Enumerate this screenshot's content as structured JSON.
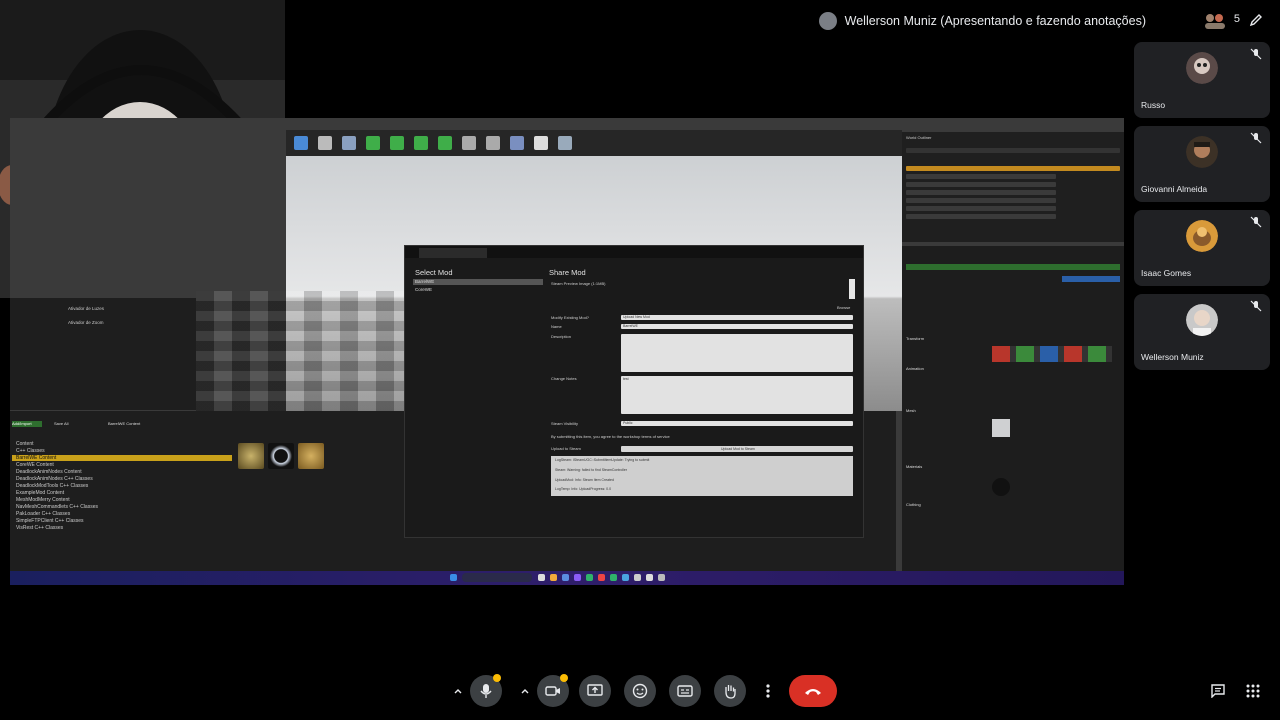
{
  "presenter": {
    "label": "Wellerson Muniz (Apresentando e fazendo anotações)",
    "participant_count": "5"
  },
  "participants": [
    {
      "name": "Russo"
    },
    {
      "name": "Giovanni Almeida"
    },
    {
      "name": "Isaac Gomes"
    },
    {
      "name": "Wellerson Muniz"
    }
  ],
  "shared_screen": {
    "dialog": {
      "select_mod_title": "Select Mod",
      "share_mod_title": "Share Mod",
      "mod_list": [
        "BarrelWE",
        "CoreWE"
      ],
      "fields": {
        "preview_image_label": "Steam Preview Image (1:1MB)",
        "modify_existing_label": "Modify Existing Mod?",
        "modify_existing_value": "Upload New Mod",
        "name_label": "Name",
        "name_value": "BarrelWE",
        "description_label": "Description",
        "change_notes_label": "Change Notes",
        "change_notes_value": "test",
        "visibility_label": "Steam Visibility",
        "visibility_value": "Public",
        "agree_text": "By submitting this item, you agree to the workshop terms of service",
        "upload_label": "Upload to Steam",
        "upload_button": "Upload Mod to Steam",
        "browse_label": "Browse"
      },
      "log_lines": [
        "LogSteam: ISteamUGC::SubmitItemUpdate: Trying to submit",
        "Steam: Warning: failed to find SteamController",
        "UploadMod: Info: Steam Item Created",
        "LogTemp: Info: UploadProgress: 0.0"
      ]
    },
    "content_browser": {
      "tabs": [
        "Add/Import",
        "Save All"
      ],
      "path": "BarrelWE Content",
      "folders": [
        "Content",
        "C++ Classes",
        "BarrelWE Content",
        "CoreWE Content",
        "DeadlockAnimNodes Content",
        "DeadlockAnimNodes C++ Classes",
        "DeadlockModTools C++ Classes",
        "ExampleMod Content",
        "MeshModMerry Content",
        "NavMeshCommandlets C++ Classes",
        "PakLoader C++ Classes",
        "SimpleFTPClient C++ Classes",
        "VisRest C++ Classes"
      ]
    },
    "panels": {
      "left_items": [
        "Ativador de Luzes",
        "Ativador de Zoom"
      ],
      "outliner_title": "World Outliner",
      "details_sections": [
        "Transform",
        "Animation",
        "Mesh",
        "Materials",
        "Clothing"
      ]
    }
  },
  "controls": {
    "buttons": [
      "chevron-up",
      "mic",
      "chevron-up",
      "camera",
      "present",
      "emoji",
      "captions",
      "raise-hand",
      "more"
    ],
    "right_buttons": [
      "chat",
      "activities"
    ]
  },
  "colors": {
    "end_call": "#d93025",
    "accent_yellow": "#fbbc04",
    "tile_bg": "#202124"
  }
}
